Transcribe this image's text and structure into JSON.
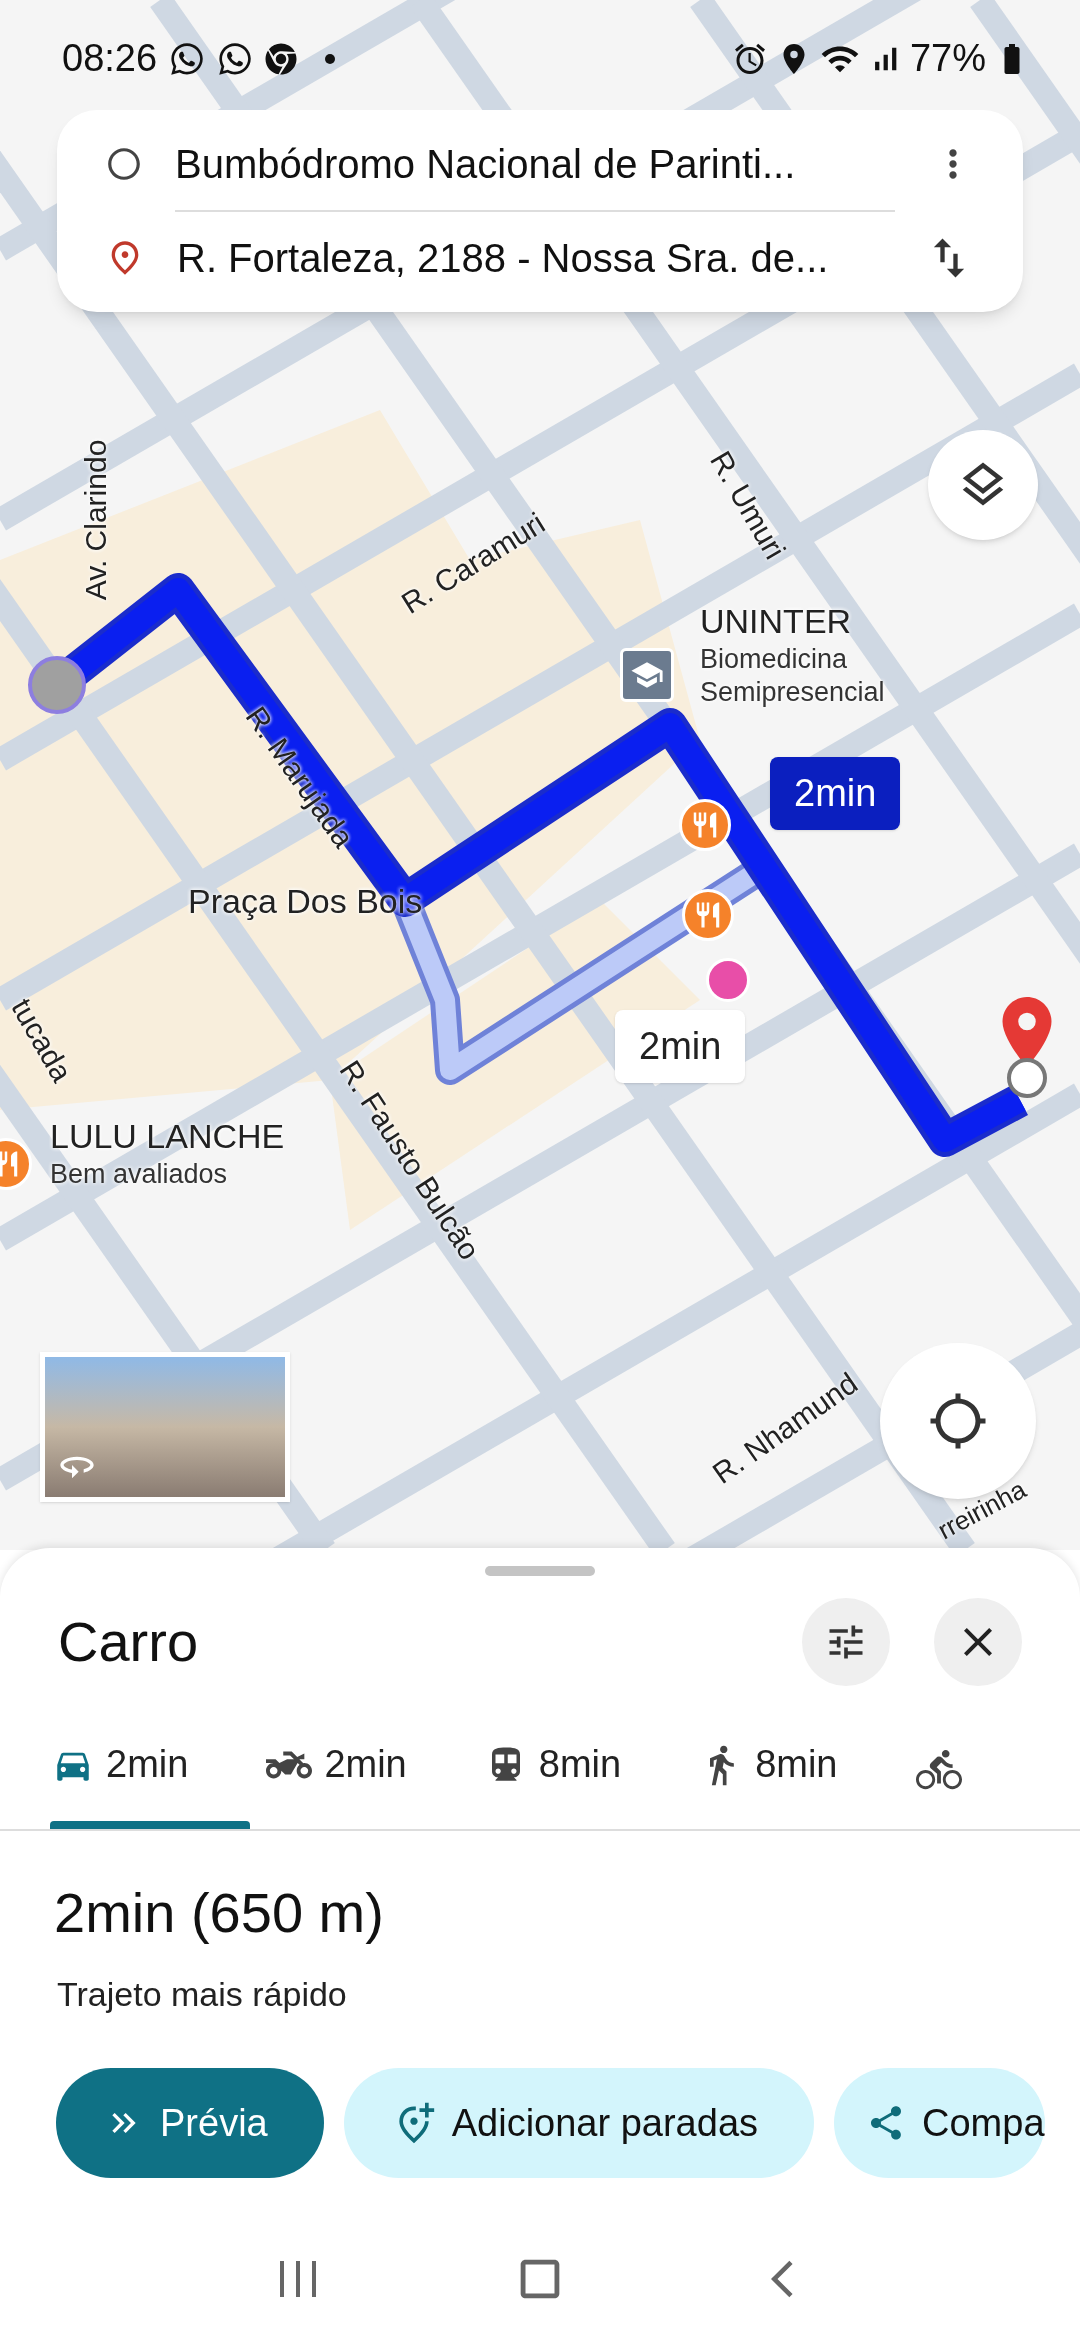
{
  "status_bar": {
    "time": "08:26",
    "battery": "77%"
  },
  "directions": {
    "origin": "Bumbódromo Nacional de Parinti...",
    "destination": "R. Fortaleza, 2188 - Nossa Sra. de..."
  },
  "map": {
    "street_labels": [
      "Av. Clarindo",
      "R. Caramuri",
      "R. Umuri",
      "R. Marujada",
      "R. Fausto Bulcão",
      "R. Nhamund",
      "rreirinha",
      "tucada"
    ],
    "places": [
      {
        "kind": "school",
        "name": "UNINTER",
        "details": [
          "Biomedicina",
          "Semipresencial"
        ]
      },
      {
        "kind": "plaza",
        "name": "Praça Dos Bois"
      },
      {
        "kind": "restaurant",
        "name": "LULU LANCHE",
        "details": [
          "Bem avaliados"
        ]
      }
    ],
    "route_labels": [
      {
        "text": "2min",
        "selected": true
      },
      {
        "text": "2min",
        "selected": false
      }
    ]
  },
  "sheet": {
    "title": "Carro",
    "modes": [
      {
        "kind": "car",
        "label": "2min",
        "selected": true
      },
      {
        "kind": "motorcycle",
        "label": "2min",
        "selected": false
      },
      {
        "kind": "transit",
        "label": "8min",
        "selected": false
      },
      {
        "kind": "walk",
        "label": "8min",
        "selected": false
      },
      {
        "kind": "bike",
        "selected": false
      }
    ],
    "summary": "2min (650 m)",
    "note": "Trajeto mais rápido",
    "actions": [
      {
        "kind": "preview",
        "label": "Prévia"
      },
      {
        "kind": "add_stops",
        "label": "Adicionar paradas"
      },
      {
        "kind": "share",
        "label": "Compa"
      }
    ]
  }
}
